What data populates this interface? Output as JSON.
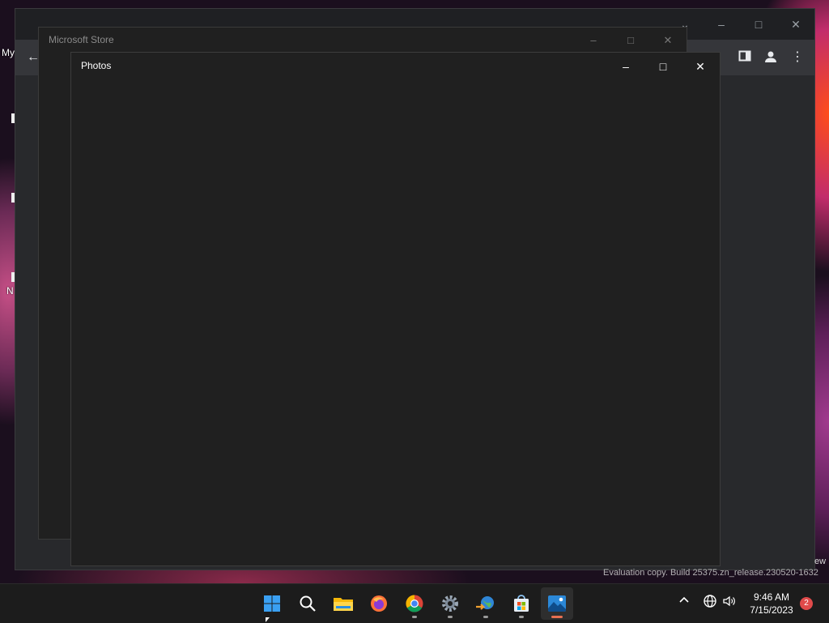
{
  "desktop": {
    "fragment_my": "My",
    "fragment_n": "N"
  },
  "chrome": {
    "controls": {
      "tabsearch_icon": "chevron-down-icon",
      "minimize_icon": "minimize-icon",
      "maximize_icon": "maximize-icon",
      "close_icon": "close-icon"
    },
    "toolbar": {
      "back_icon": "arrow-left-icon",
      "sidepanel_icon": "side-panel-icon",
      "profile_icon": "person-icon",
      "menu_icon": "kebab-menu-icon"
    }
  },
  "store_window": {
    "title": "Microsoft Store"
  },
  "photos_window": {
    "title": "Photos"
  },
  "watermark": {
    "text": "Evaluation copy. Build 25375.zn_release.230520-1632",
    "suffix": "ew"
  },
  "taskbar": {
    "apps": [
      {
        "name": "start",
        "icon": "windows-logo-icon"
      },
      {
        "name": "search",
        "icon": "search-icon"
      },
      {
        "name": "file-explorer",
        "icon": "folder-icon"
      },
      {
        "name": "firefox",
        "icon": "firefox-icon"
      },
      {
        "name": "chrome",
        "icon": "chrome-icon"
      },
      {
        "name": "settings",
        "icon": "gear-icon"
      },
      {
        "name": "network-app",
        "icon": "globe-arrow-icon"
      },
      {
        "name": "microsoft-store",
        "icon": "store-bag-icon"
      },
      {
        "name": "photos",
        "icon": "photos-icon"
      }
    ],
    "tray": {
      "time": "9:46 AM",
      "date": "7/15/2023",
      "notifications": "2"
    }
  },
  "colors": {
    "taskbar_bg": "#1c1c1c",
    "window_bg": "#202020",
    "active_indicator": "#e76f51",
    "windows_blue": "#3aa0f3"
  }
}
